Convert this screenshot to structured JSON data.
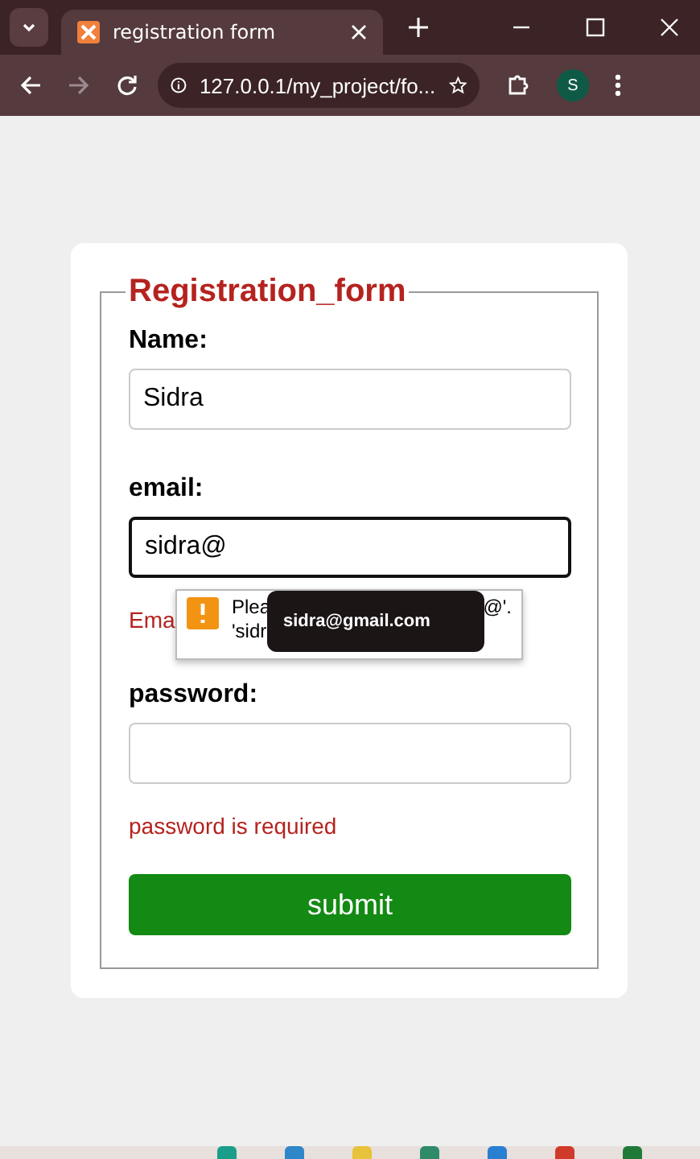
{
  "browser": {
    "tab": {
      "title": "registration form",
      "selected": true
    },
    "address": "127.0.0.1/my_project/fo...",
    "profile": "S"
  },
  "form": {
    "legend": "Registration_form",
    "fields": [
      {
        "label": "Name:",
        "value": "Sidra",
        "focused": false
      },
      {
        "label": "email:",
        "value": "sidra@",
        "focused": true,
        "error": "Ema"
      },
      {
        "label": "password:",
        "focused": false,
        "error": "password is required"
      }
    ],
    "submit": "submit"
  },
  "validation_popup": {
    "line_1_start": "Plea",
    "line_1_end": "@'.",
    "line_2": "'sidr"
  },
  "autocomplete": {
    "suggestion": "sidra@gmail.com"
  }
}
